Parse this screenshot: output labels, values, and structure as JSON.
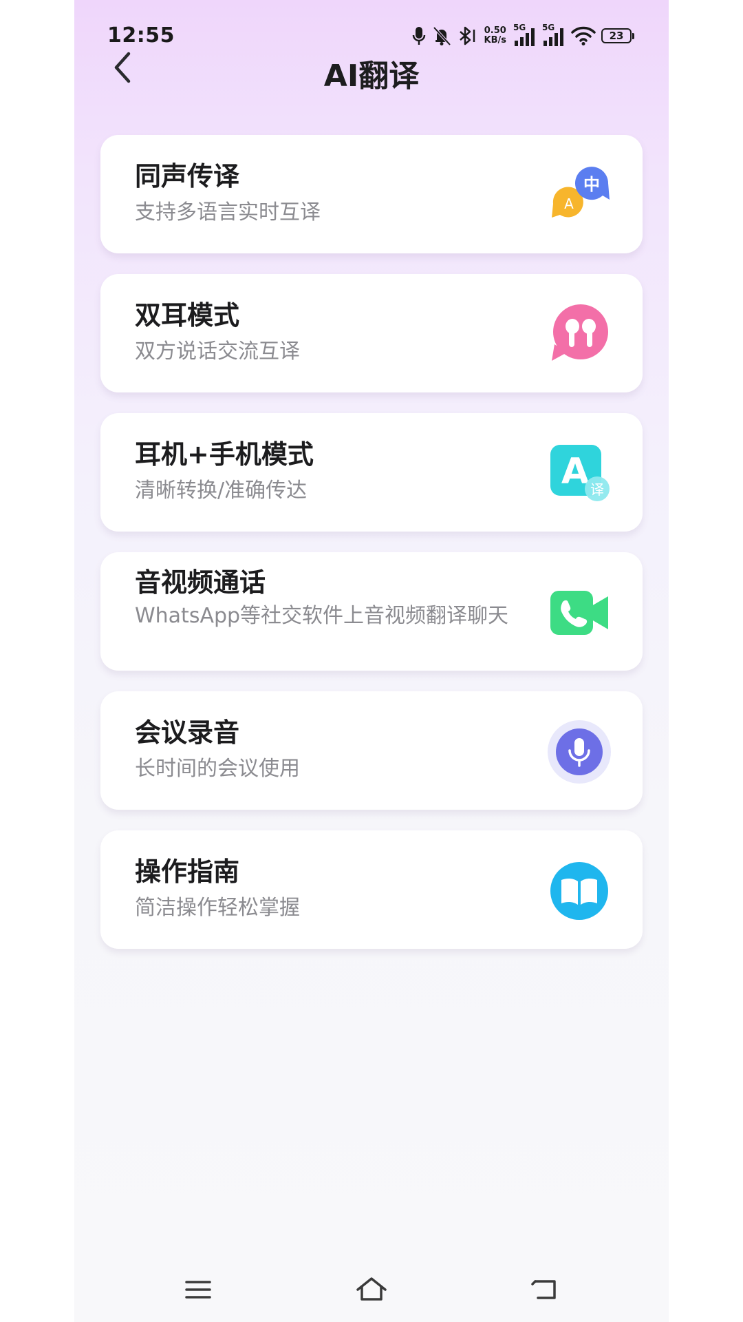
{
  "status_bar": {
    "time": "12:55",
    "net_speed_value": "0.50",
    "net_speed_unit": "KB/s",
    "signal_1_label": "5G",
    "signal_2_label": "5G",
    "battery_level": "23",
    "icons": [
      "microphone-icon",
      "bell-muted-icon",
      "bluetooth-icon",
      "signal-icon",
      "wifi-icon",
      "battery-icon"
    ]
  },
  "header": {
    "title": "AI翻译",
    "back_icon": "chevron-left-icon"
  },
  "cards": [
    {
      "title": "同声传译",
      "desc": "支持多语言实时互译",
      "icon": "chat-translate-icon",
      "accent": "#5b7ef0"
    },
    {
      "title": "双耳模式",
      "desc": "双方说话交流互译",
      "icon": "earbuds-icon",
      "accent": "#f36fa8"
    },
    {
      "title": "耳机+手机模式",
      "desc": "清晰转换/准确传达",
      "icon": "letter-a-translate-icon",
      "accent": "#2fd4dc"
    },
    {
      "title": "音视频通话",
      "desc": "WhatsApp等社交软件上音视频翻译聊天",
      "icon": "video-call-icon",
      "accent": "#3ddc84"
    },
    {
      "title": "会议录音",
      "desc": "长时间的会议使用",
      "icon": "microphone-icon",
      "accent": "#6d6fe6"
    },
    {
      "title": "操作指南",
      "desc": "简洁操作轻松掌握",
      "icon": "book-icon",
      "accent": "#1fb6ee"
    }
  ],
  "nav_bar": {
    "icons": [
      "menu-icon",
      "home-icon",
      "back-icon"
    ]
  }
}
